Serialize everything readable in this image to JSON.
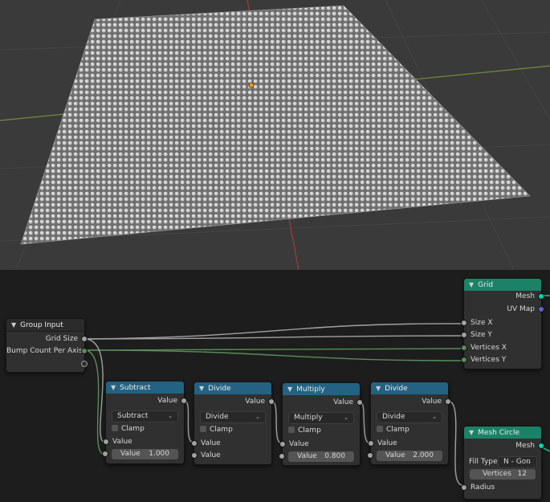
{
  "nodes": {
    "group_input": {
      "title": "Group Input",
      "outputs": [
        "Grid Size",
        "Bump Count Per Axis"
      ]
    },
    "grid": {
      "title": "Grid",
      "outputs": [
        "Mesh",
        "UV Map"
      ],
      "inputs": [
        "Size X",
        "Size Y",
        "Vertices X",
        "Vertices Y"
      ]
    },
    "subtract": {
      "title": "Subtract",
      "output": "Value",
      "operation": "Subtract",
      "clamp_label": "Clamp",
      "input_label": "Value",
      "field_label": "Value",
      "field_value": "1.000"
    },
    "divide1": {
      "title": "Divide",
      "output": "Value",
      "operation": "Divide",
      "clamp_label": "Clamp",
      "input1_label": "Value",
      "input2_label": "Value"
    },
    "multiply": {
      "title": "Multiply",
      "output": "Value",
      "operation": "Multiply",
      "clamp_label": "Clamp",
      "input_label": "Value",
      "field_label": "Value",
      "field_value": "0.800"
    },
    "divide2": {
      "title": "Divide",
      "output": "Value",
      "operation": "Divide",
      "clamp_label": "Clamp",
      "input_label": "Value",
      "field_label": "Value",
      "field_value": "2.000"
    },
    "mesh_circle": {
      "title": "Mesh Circle",
      "output": "Mesh",
      "fill_type_label": "Fill Type",
      "fill_type": "N - Gon",
      "vertices_label": "Vertices",
      "vertices_value": "12",
      "radius_label": "Radius"
    }
  },
  "colors": {
    "math_header": "#246283",
    "geometry_header": "#1b8268",
    "float_socket": "#a1a1a1",
    "geometry_socket": "#00d6a3",
    "vector_socket": "#6363c7",
    "integer_socket": "#598c5c"
  },
  "icons": [
    "chevron-down-icon",
    "dropdown-arrow-icon",
    "checkbox-icon",
    "origin-dot-icon"
  ]
}
